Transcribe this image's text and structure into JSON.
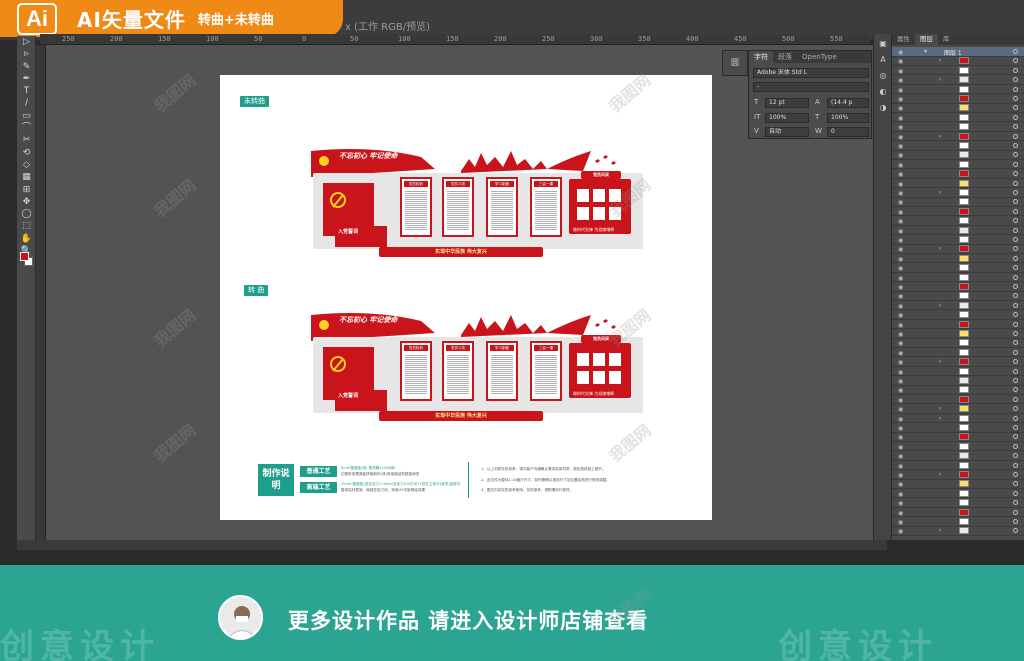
{
  "header": {
    "badge_logo": "Ai",
    "badge_title": "AI矢量文件",
    "badge_subtitle": "转曲+未转曲",
    "doc_tab": "x (工作 RGB/预览)"
  },
  "ruler": {
    "top_ticks": [
      "250",
      "200",
      "150",
      "100",
      "50",
      "0",
      "50",
      "100",
      "150",
      "200",
      "250",
      "300",
      "350",
      "400",
      "450",
      "500",
      "550"
    ]
  },
  "tools": [
    "▷",
    "▹",
    "✎",
    "✒",
    "T",
    "/",
    "▭",
    "⌒",
    "✂",
    "⟲",
    "◇",
    "▦",
    "⊞",
    "✥",
    "◯",
    "⬚",
    "✋",
    "🔍"
  ],
  "artboard": {
    "tag_unconverted": "未转曲",
    "tag_converted": "转 曲",
    "walls": [
      {
        "slogan": "不忘初心 牢记使命",
        "red_sub": "入党誓词",
        "cards": [
          "党员权利",
          "党员义务",
          "学习制度",
          "三会一课"
        ],
        "grid_label": "党员风采",
        "grid_foot": "做时代先锋 为党旗增辉",
        "foot_band": "实现中华民族  伟大复兴"
      },
      {
        "slogan": "不忘初心 牢记使命",
        "red_sub": "入党誓词",
        "cards": [
          "党员权利",
          "党员义务",
          "学习制度",
          "三会一课"
        ],
        "grid_label": "党员风采",
        "grid_foot": "做时代先锋 为党旗增辉",
        "foot_band": "实现中华民族  伟大复兴"
      }
    ],
    "notes": {
      "title": "制作说明",
      "tag_normal": "普通工艺",
      "tag_premium": "高端工艺",
      "normal_lines": [
        "5mm雪弗板(或) 覆亮膜+UV印刷",
        "边框采用雪弗板拼接制作(或)采用钢结构框架烤漆"
      ],
      "premium_lines": [
        "15mm雪弗板(或亚克力)+3mm亚克力(UV打印)+铁艺立体字(烤漆)金属字",
        "整体铝材框架，局部亚克力设，采用UV平板喷绘效果"
      ],
      "right_lines": [
        "1、以上材质仅供参考，请与客户沟通确认需求选用材质，规定具体施工细节。",
        "2、此文件为整体1:10缩尺尺寸，制作需确认现场尺寸及位置后再进行修改调整。",
        "3、图文内容仅供参考使用，仅供参考，请酌情自行修改。"
      ]
    }
  },
  "char_panel": {
    "tabs": [
      "字符",
      "段落",
      "OpenType"
    ],
    "font_family": "Adobe 宋体 Std L",
    "font_style": "-",
    "font_size": "12 pt",
    "leading": "(14.4 p",
    "scale_v": "100%",
    "scale_h": "100%",
    "kerning": "自动",
    "tracking": "0"
  },
  "side_dock_label": "圆",
  "mini_tools": [
    "▣",
    "A",
    "◎",
    "◐",
    "◑"
  ],
  "layers": {
    "tabs": [
      "属性",
      "图层",
      "库"
    ],
    "top_layer_name": "图层 1",
    "row_count": 52
  },
  "banner": {
    "text": "更多设计作品 请进入设计师店铺查看",
    "ghost_left": "创意设计",
    "ghost_right": "创意设计"
  },
  "watermark_text": "我图网",
  "colors": {
    "accent_orange": "#f08a17",
    "teal": "#1f9e8b",
    "party_red": "#c8141a"
  }
}
